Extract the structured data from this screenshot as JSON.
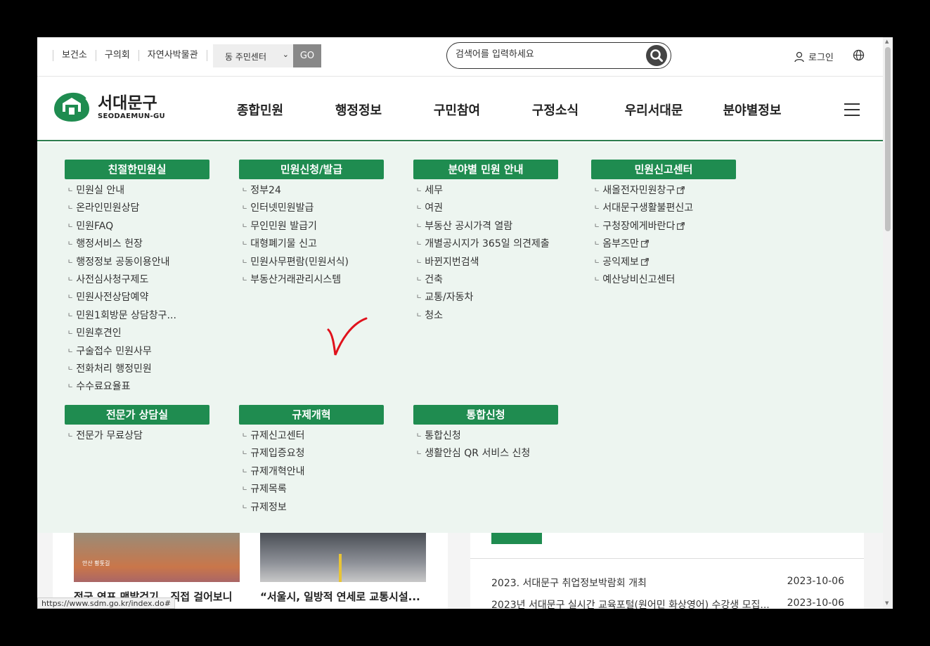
{
  "topbar": {
    "links": [
      "보건소",
      "구의회",
      "자연사박물관"
    ],
    "dong_select": "동 주민센터",
    "go_label": "GO",
    "search_placeholder": "검색어를 입력하세요",
    "login_label": "로그인"
  },
  "header": {
    "logo_ko": "서대문구",
    "logo_en": "SEODAEMUN-GU",
    "nav": [
      "종합민원",
      "행정정보",
      "구민참여",
      "구정소식",
      "우리서대문",
      "분야별정보"
    ]
  },
  "mega": {
    "col1": {
      "title": "친절한민원실",
      "items": [
        "민원실 안내",
        "온라인민원상담",
        "민원FAQ",
        "행정서비스 헌장",
        "행정정보 공동이용안내",
        "사전심사청구제도",
        "민원사전상담예약",
        "민원1회방문 상담창구...",
        "민원후견인",
        "구술접수 민원사무",
        "전화처리 행정민원",
        "수수료요율표"
      ]
    },
    "col2": {
      "title": "민원신청/발급",
      "items": [
        "정부24",
        "인터넷민원발급",
        "무인민원 발급기",
        "대형폐기물 신고",
        "민원사무편람(민원서식)",
        "부동산거래관리시스템"
      ]
    },
    "col3": {
      "title": "분야별 민원 안내",
      "items": [
        "세무",
        "여권",
        "부동산 공시가격 열람",
        "개별공시지가 365일 의견제출",
        "바뀐지번검색",
        "건축",
        "교통/자동차",
        "청소"
      ]
    },
    "col4": {
      "title": "민원신고센터",
      "items": [
        "새올전자민원창구",
        "서대문구생활불편신고",
        "구청장에게바란다",
        "옴부즈만",
        "공익제보",
        "예산낭비신고센터"
      ]
    },
    "col5": {
      "title": "전문가 상담실",
      "items": [
        "전문가 무료상담"
      ]
    },
    "col6": {
      "title": "규제개혁",
      "items": [
        "규제신고센터",
        "규제입증요청",
        "규제개혁안내",
        "규제목록",
        "규제정보"
      ]
    },
    "col7": {
      "title": "통합신청",
      "items": [
        "통합신청",
        "생활안심 QR 서비스 신청"
      ]
    }
  },
  "below": {
    "caption1": "정국 연표 맨발걷기.. 직접 걸어보니",
    "caption2": "“서울시, 일방적 연세로 교통시설...",
    "photo1_label": "안산 황톳길",
    "news": [
      {
        "title": "2023. 서대문구 취업정보박람회 개최",
        "date": "2023-10-06"
      },
      {
        "title": "2023년 서대문구 실시간 교육포털(원어민 화상영어) 수강생 모집...",
        "date": "2023-10-06"
      }
    ]
  },
  "status_url": "https://www.sdm.go.kr/index.do#",
  "colors": {
    "brand_green": "#1f8c50",
    "menu_bg": "#edf5f0",
    "annotation_red": "#e0121c"
  }
}
